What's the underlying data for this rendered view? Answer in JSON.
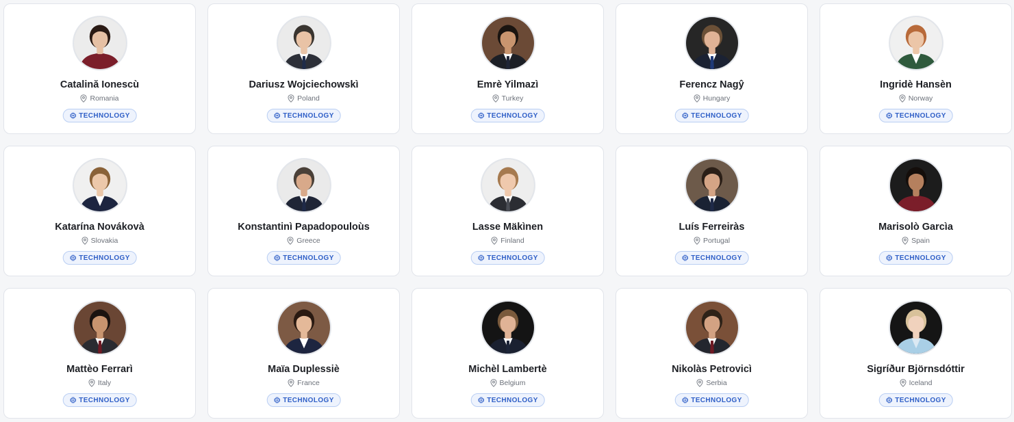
{
  "people": [
    {
      "name": "Catalină Ionescù",
      "location": "Romania",
      "category": "TECHNOLOGY",
      "bg": "#ececec",
      "skin": "#e6c0a4",
      "hair": "#2a1a14",
      "suit": "#7b1e2a",
      "shirt": "#7b1e2a",
      "tie": ""
    },
    {
      "name": "Dariusz Wojciechowskì",
      "location": "Poland",
      "category": "TECHNOLOGY",
      "bg": "#ebebeb",
      "skin": "#e9c3a6",
      "hair": "#3a3530",
      "suit": "#2c2f38",
      "shirt": "#ffffff",
      "tie": "#1f2c4a"
    },
    {
      "name": "Emrè Yilmazì",
      "location": "Turkey",
      "category": "TECHNOLOGY",
      "bg": "#6b4a36",
      "skin": "#c9956f",
      "hair": "#1a1410",
      "suit": "#1c1f26",
      "shirt": "#ffffff",
      "tie": "#1f2536"
    },
    {
      "name": "Ferencz Nagŷ",
      "location": "Hungary",
      "category": "TECHNOLOGY",
      "bg": "#262626",
      "skin": "#e0b396",
      "hair": "#6b5037",
      "suit": "#1b2233",
      "shirt": "#ffffff",
      "tie": "#1f3a78"
    },
    {
      "name": "Ingridè Hansèn",
      "location": "Norway",
      "category": "TECHNOLOGY",
      "bg": "#f0f0f0",
      "skin": "#ecc6a8",
      "hair": "#b86a3a",
      "suit": "#2f5a3d",
      "shirt": "#ffffff",
      "tie": ""
    },
    {
      "name": "Katarína Novákovà",
      "location": "Slovakia",
      "category": "TECHNOLOGY",
      "bg": "#f0f0f0",
      "skin": "#ecc8aa",
      "hair": "#8a6238",
      "suit": "#1d2540",
      "shirt": "#ffffff",
      "tie": ""
    },
    {
      "name": "Konstantinì Papadopouloùs",
      "location": "Greece",
      "category": "TECHNOLOGY",
      "bg": "#eaeaea",
      "skin": "#d8a98a",
      "hair": "#4a4038",
      "suit": "#1f2536",
      "shirt": "#ffffff",
      "tie": "#1f2a48"
    },
    {
      "name": "Lasse Mäkìnen",
      "location": "Finland",
      "category": "TECHNOLOGY",
      "bg": "#eeeeee",
      "skin": "#efc9ad",
      "hair": "#a67a4f",
      "suit": "#2b2d33",
      "shirt": "#ffffff",
      "tie": "#4a4d55"
    },
    {
      "name": "Luís Ferreiràs",
      "location": "Portugal",
      "category": "TECHNOLOGY",
      "bg": "#6d5a4a",
      "skin": "#d4a485",
      "hair": "#2b1f17",
      "suit": "#1a2233",
      "shirt": "#ffffff",
      "tie": "#1f2a48"
    },
    {
      "name": "Marisolò Garcìa",
      "location": "Spain",
      "category": "TECHNOLOGY",
      "bg": "#1c1c1c",
      "skin": "#b5805e",
      "hair": "#140e0b",
      "suit": "#7b1e2a",
      "shirt": "#7b1e2a",
      "tie": ""
    },
    {
      "name": "Mattèo Ferrarì",
      "location": "Italy",
      "category": "TECHNOLOGY",
      "bg": "#6a4634",
      "skin": "#c8946f",
      "hair": "#1a1310",
      "suit": "#2a2b31",
      "shirt": "#ffffff",
      "tie": "#6e1a24"
    },
    {
      "name": "Maïa Duplessiè",
      "location": "France",
      "category": "TECHNOLOGY",
      "bg": "#7d5a44",
      "skin": "#e4b999",
      "hair": "#2a1a12",
      "suit": "#1d2540",
      "shirt": "#ffffff",
      "tie": ""
    },
    {
      "name": "Michèl Lambertè",
      "location": "Belgium",
      "category": "TECHNOLOGY",
      "bg": "#141414",
      "skin": "#e0b396",
      "hair": "#7a5a3c",
      "suit": "#1a2030",
      "shirt": "#ffffff",
      "tie": "#1c2438"
    },
    {
      "name": "Nikolàs Petrovicì",
      "location": "Serbia",
      "category": "TECHNOLOGY",
      "bg": "#7a5038",
      "skin": "#d3a283",
      "hair": "#2e2218",
      "suit": "#23262e",
      "shirt": "#ffffff",
      "tie": "#6e1a24"
    },
    {
      "name": "Sigríður Björnsdóttir",
      "location": "Iceland",
      "category": "TECHNOLOGY",
      "bg": "#151515",
      "skin": "#f0d2bd",
      "hair": "#d8c19a",
      "suit": "#a9cfe6",
      "shirt": "#dbe9f3",
      "tie": ""
    }
  ]
}
